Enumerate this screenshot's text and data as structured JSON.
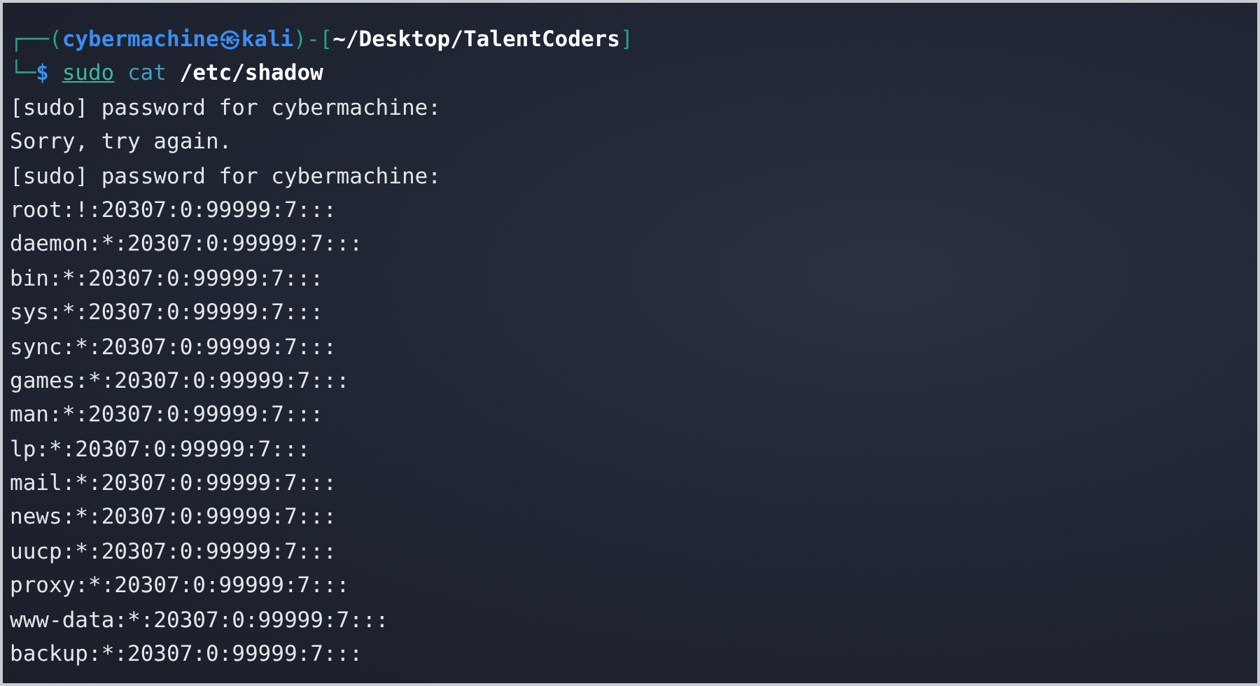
{
  "prompt": {
    "segments": [
      {
        "kind": "frame",
        "text": "┌──("
      },
      {
        "kind": "user",
        "text": "cybermachine"
      },
      {
        "kind": "symbol",
        "text": "㉿"
      },
      {
        "kind": "host",
        "text": "kali"
      },
      {
        "kind": "frame",
        "text": ")-["
      },
      {
        "kind": "path",
        "text": "~/Desktop/TalentCoders"
      },
      {
        "kind": "frame",
        "text": "]"
      }
    ]
  },
  "command": {
    "segments": [
      {
        "kind": "frame",
        "text": "└─"
      },
      {
        "kind": "sign",
        "text": "$"
      },
      {
        "kind": "program",
        "text": "sudo"
      },
      {
        "kind": "word",
        "text": "cat"
      },
      {
        "kind": "argument",
        "text": "/etc/shadow"
      }
    ]
  },
  "output": [
    "[sudo] password for cybermachine:",
    "Sorry, try again.",
    "[sudo] password for cybermachine:",
    "root:!:20307:0:99999:7:::",
    "daemon:*:20307:0:99999:7:::",
    "bin:*:20307:0:99999:7:::",
    "sys:*:20307:0:99999:7:::",
    "sync:*:20307:0:99999:7:::",
    "games:*:20307:0:99999:7:::",
    "man:*:20307:0:99999:7:::",
    "lp:*:20307:0:99999:7:::",
    "mail:*:20307:0:99999:7:::",
    "news:*:20307:0:99999:7:::",
    "uucp:*:20307:0:99999:7:::",
    "proxy:*:20307:0:99999:7:::",
    "www-data:*:20307:0:99999:7:::",
    "backup:*:20307:0:99999:7:::"
  ]
}
